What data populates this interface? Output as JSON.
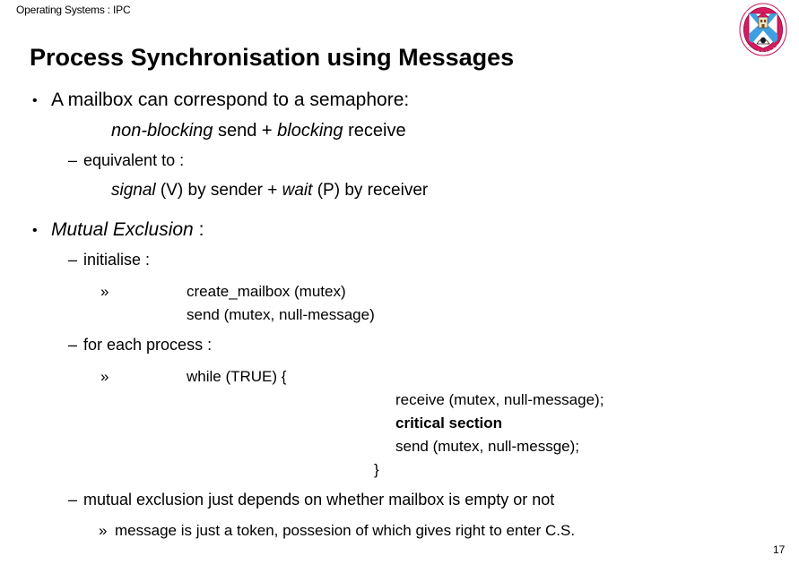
{
  "slide": {
    "header": "Operating Systems : IPC",
    "title": "Process Synchronisation using Messages",
    "page_number": "17",
    "logo": {
      "name": "university-of-edinburgh-crest",
      "ring_color": "#c2185b",
      "field_color": "#d81b60",
      "saltire_color": "#3f9fe0",
      "shield_color": "#ffffff",
      "ring_text": "THE UNIVERSITY OF EDINBURGH"
    },
    "markers": {
      "bullet": "•",
      "dash": "–",
      "guillemet": "»"
    },
    "content": [
      {
        "id": "mailbox-semaphore",
        "level": 1,
        "text": "A mailbox can correspond to a semaphore:"
      },
      {
        "id": "nonblocking-blocking",
        "level": "1-sub",
        "parts": [
          {
            "text": "non-blocking",
            "style": "italic"
          },
          {
            "text": " send  + ",
            "style": "normal"
          },
          {
            "text": "blocking",
            "style": "italic"
          },
          {
            "text": " receive",
            "style": "normal"
          }
        ]
      },
      {
        "id": "equivalent-to",
        "level": 2,
        "text": "equivalent to :"
      },
      {
        "id": "signal-wait",
        "level": "2-sub",
        "parts": [
          {
            "text": "signal",
            "style": "italic"
          },
          {
            "text": " (V) by sender  + ",
            "style": "normal"
          },
          {
            "text": "wait",
            "style": "italic"
          },
          {
            "text": " (P) by receiver",
            "style": "normal"
          }
        ]
      },
      {
        "id": "mutual-exclusion",
        "level": 1,
        "parts": [
          {
            "text": "Mutual Exclusion",
            "style": "italic"
          },
          {
            "text": " :",
            "style": "normal"
          }
        ]
      },
      {
        "id": "initialise",
        "level": 2,
        "text": "initialise :"
      },
      {
        "id": "init-code",
        "level": 3,
        "lines": [
          "create_mailbox (mutex)",
          "send (mutex, null-message)"
        ]
      },
      {
        "id": "for-each-process",
        "level": 2,
        "text": "for each process :"
      },
      {
        "id": "process-code",
        "level": 3,
        "lines": [
          "while (TRUE) {",
          "receive (mutex, null-message);",
          "critical section",
          "send (mutex, null-messge);",
          "}"
        ],
        "bold_line_index": 2
      },
      {
        "id": "mutual-exclusion-note",
        "level": 2,
        "text": "mutual exclusion just depends on whether mailbox is empty or not"
      },
      {
        "id": "token-note",
        "level": "3-tight",
        "text": "message is just a token, possesion of which gives right to enter C.S."
      }
    ]
  }
}
